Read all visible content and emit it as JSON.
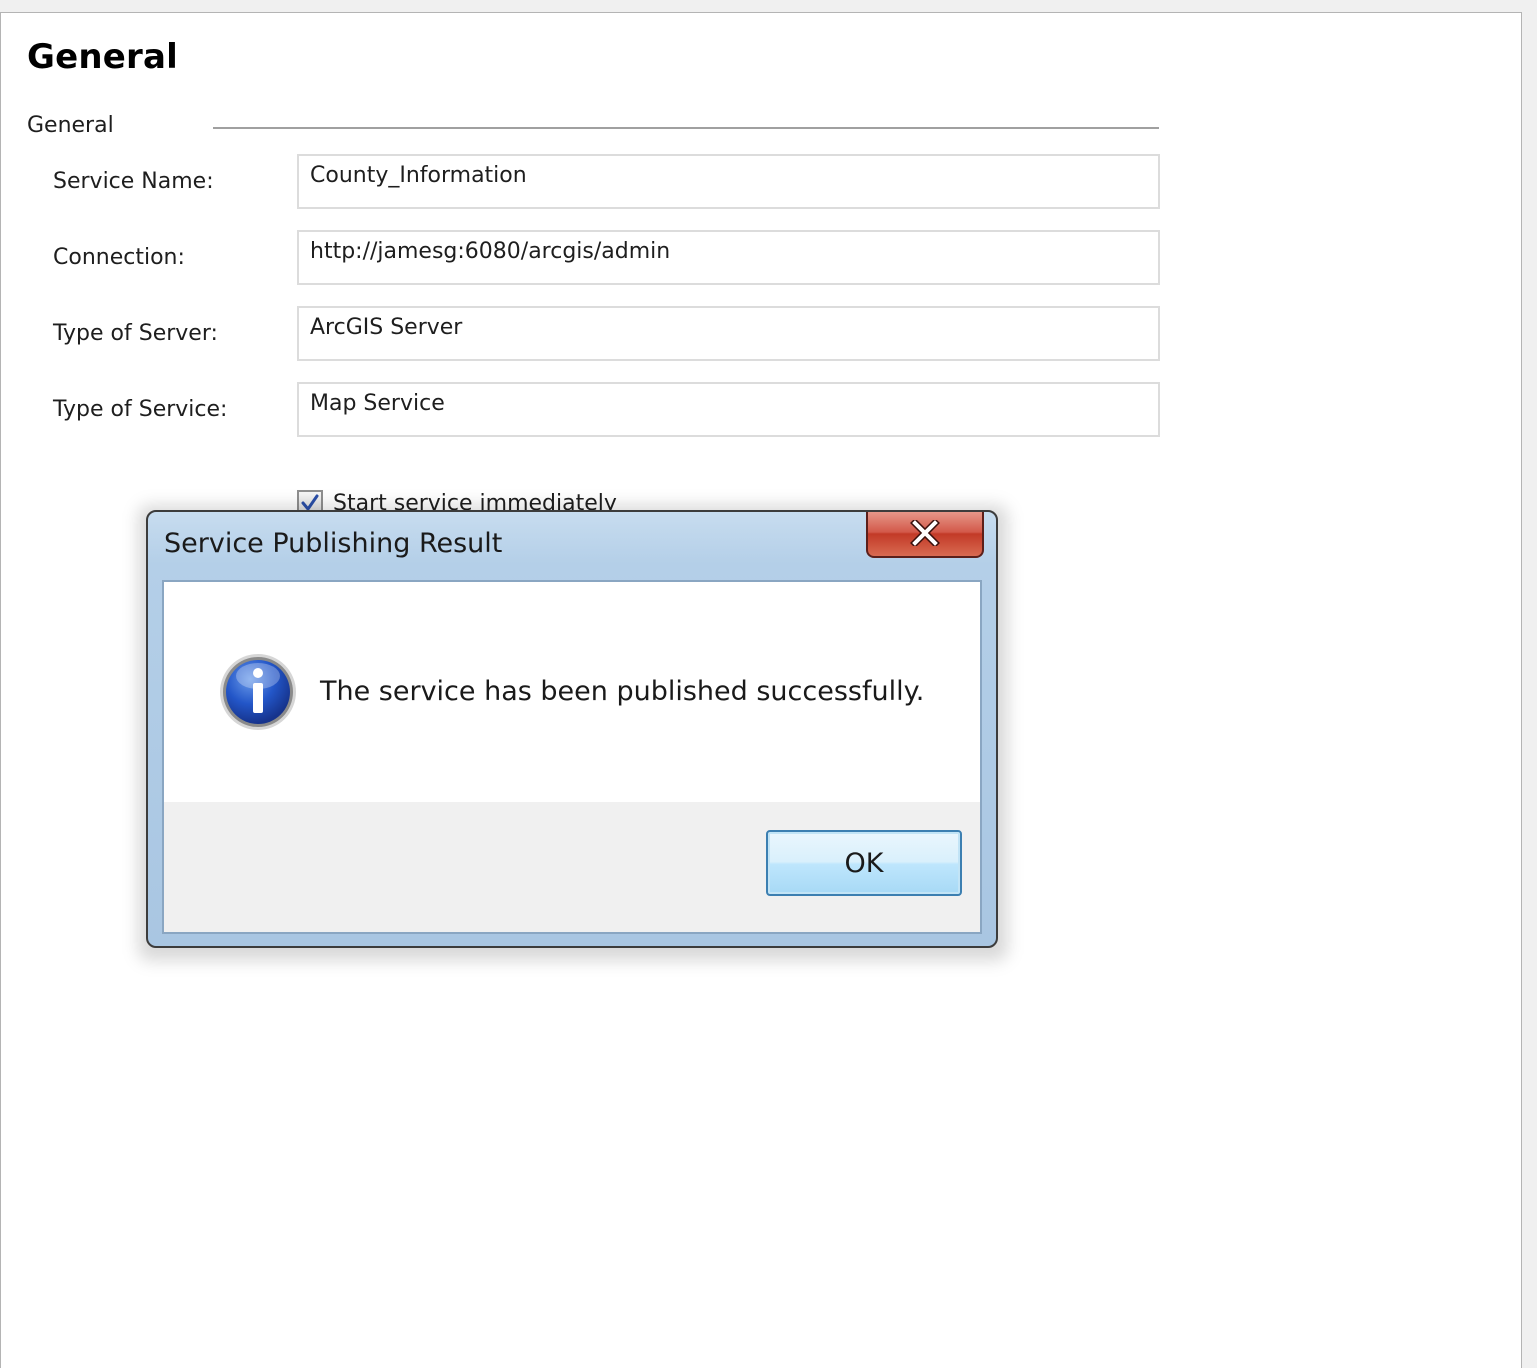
{
  "page": {
    "title": "General"
  },
  "group": {
    "label": "General"
  },
  "fields": {
    "service_name": {
      "label": "Service Name:",
      "value": "County_Information"
    },
    "connection": {
      "label": "Connection:",
      "value": "http://jamesg:6080/arcgis/admin"
    },
    "server_type": {
      "label": "Type of Server:",
      "value": "ArcGIS Server"
    },
    "service_type": {
      "label": "Type of Service:",
      "value": "Map Service"
    }
  },
  "checkbox": {
    "label": "Start service immediately",
    "checked": true
  },
  "dialog": {
    "title": "Service Publishing Result",
    "message": "The service has been published successfully.",
    "ok_label": "OK",
    "icon": "info-icon"
  },
  "colors": {
    "dialog_frame": "#a9c6e2",
    "close_button": "#c23a27",
    "info_icon": "#1f4fb4",
    "ok_button": "#bee6fd"
  }
}
